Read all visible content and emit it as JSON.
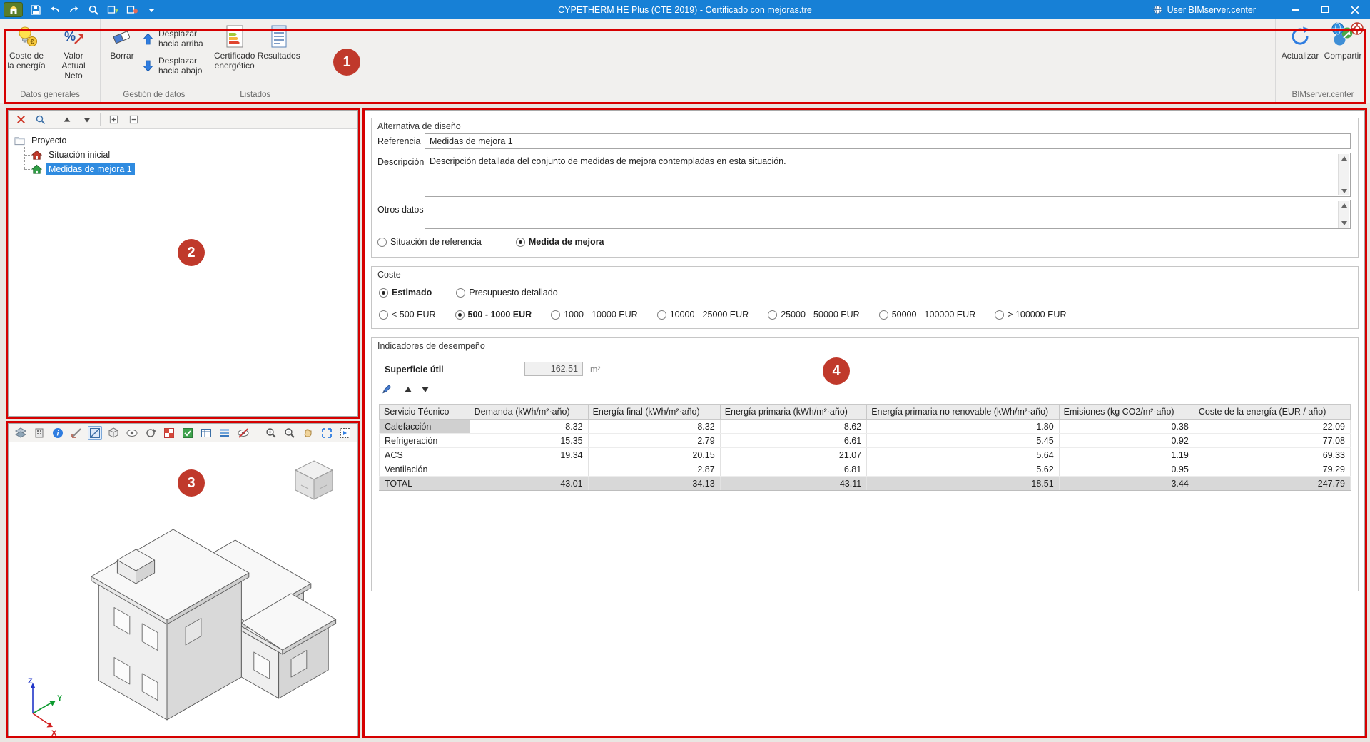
{
  "colors": {
    "titlebar_blue": "#1780d6",
    "selection_blue": "#2f8be0",
    "annotation_red": "#d60000",
    "badge_red": "#c0392b"
  },
  "titlebar": {
    "title": "CYPETHERM HE Plus (CTE 2019) - Certificado con mejoras.tre",
    "user": "User BIMserver.center"
  },
  "ribbon": {
    "coste_energia": "Coste de\nla energía",
    "valor_actual_neto": "Valor\nActual Neto",
    "borrar": "Borrar",
    "desplazar_arriba": "Desplazar\nhacia arriba",
    "desplazar_abajo": "Desplazar\nhacia abajo",
    "certificado": "Certificado\nenergético",
    "resultados": "Resultados",
    "actualizar": "Actualizar",
    "compartir": "Compartir",
    "group_datos": "Datos generales",
    "group_gestion": "Gestión de datos",
    "group_listados": "Listados",
    "group_bim": "BIMserver.center"
  },
  "tree": {
    "root": "Proyecto",
    "items": [
      {
        "label": "Situación inicial",
        "selected": false
      },
      {
        "label": "Medidas de mejora 1",
        "selected": true
      }
    ]
  },
  "form": {
    "group_title": "Alternativa de diseño",
    "referencia_label": "Referencia",
    "referencia_value": "Medidas de mejora 1",
    "descripcion_label": "Descripción",
    "descripcion_value": "Descripción detallada del conjunto de medidas de mejora contempladas en esta situación.",
    "otros_label": "Otros datos",
    "otros_value": "",
    "situacion_label": "Situación de referencia",
    "medida_label": "Medida de mejora",
    "selected_tipo": "Medida de mejora",
    "coste": {
      "title": "Coste",
      "estimado_label": "Estimado",
      "presupuesto_label": "Presupuesto detallado",
      "selected_modo": "Estimado",
      "ranges": [
        "< 500 EUR",
        "500 - 1000 EUR",
        "1000 - 10000 EUR",
        "10000 - 25000 EUR",
        "25000 - 50000 EUR",
        "50000 - 100000 EUR",
        "> 100000 EUR"
      ],
      "selected_range": "500 - 1000 EUR"
    },
    "indicadores": {
      "title": "Indicadores de desempeño",
      "superficie_label": "Superficie útil",
      "superficie_value": "162.51",
      "superficie_unit": "m²"
    }
  },
  "table": {
    "columns": [
      "Servicio Técnico",
      "Demanda (kWh/m²·año)",
      "Energía final (kWh/m²·año)",
      "Energía primaria (kWh/m²·año)",
      "Energía primaria no renovable (kWh/m²·año)",
      "Emisiones (kg CO2/m²·año)",
      "Coste de la energía (EUR / año)"
    ],
    "rows": [
      [
        "Calefacción",
        "8.32",
        "8.32",
        "8.62",
        "1.80",
        "0.38",
        "22.09"
      ],
      [
        "Refrigeración",
        "15.35",
        "2.79",
        "6.61",
        "5.45",
        "0.92",
        "77.08"
      ],
      [
        "ACS",
        "19.34",
        "20.15",
        "21.07",
        "5.64",
        "1.19",
        "69.33"
      ],
      [
        "Ventilación",
        "",
        "2.87",
        "6.81",
        "5.62",
        "0.95",
        "79.29"
      ],
      [
        "TOTAL",
        "43.01",
        "34.13",
        "43.11",
        "18.51",
        "3.44",
        "247.79"
      ]
    ],
    "focused_cell": "Calefacción"
  },
  "annotations": {
    "badges": [
      "1",
      "2",
      "3",
      "4"
    ]
  }
}
